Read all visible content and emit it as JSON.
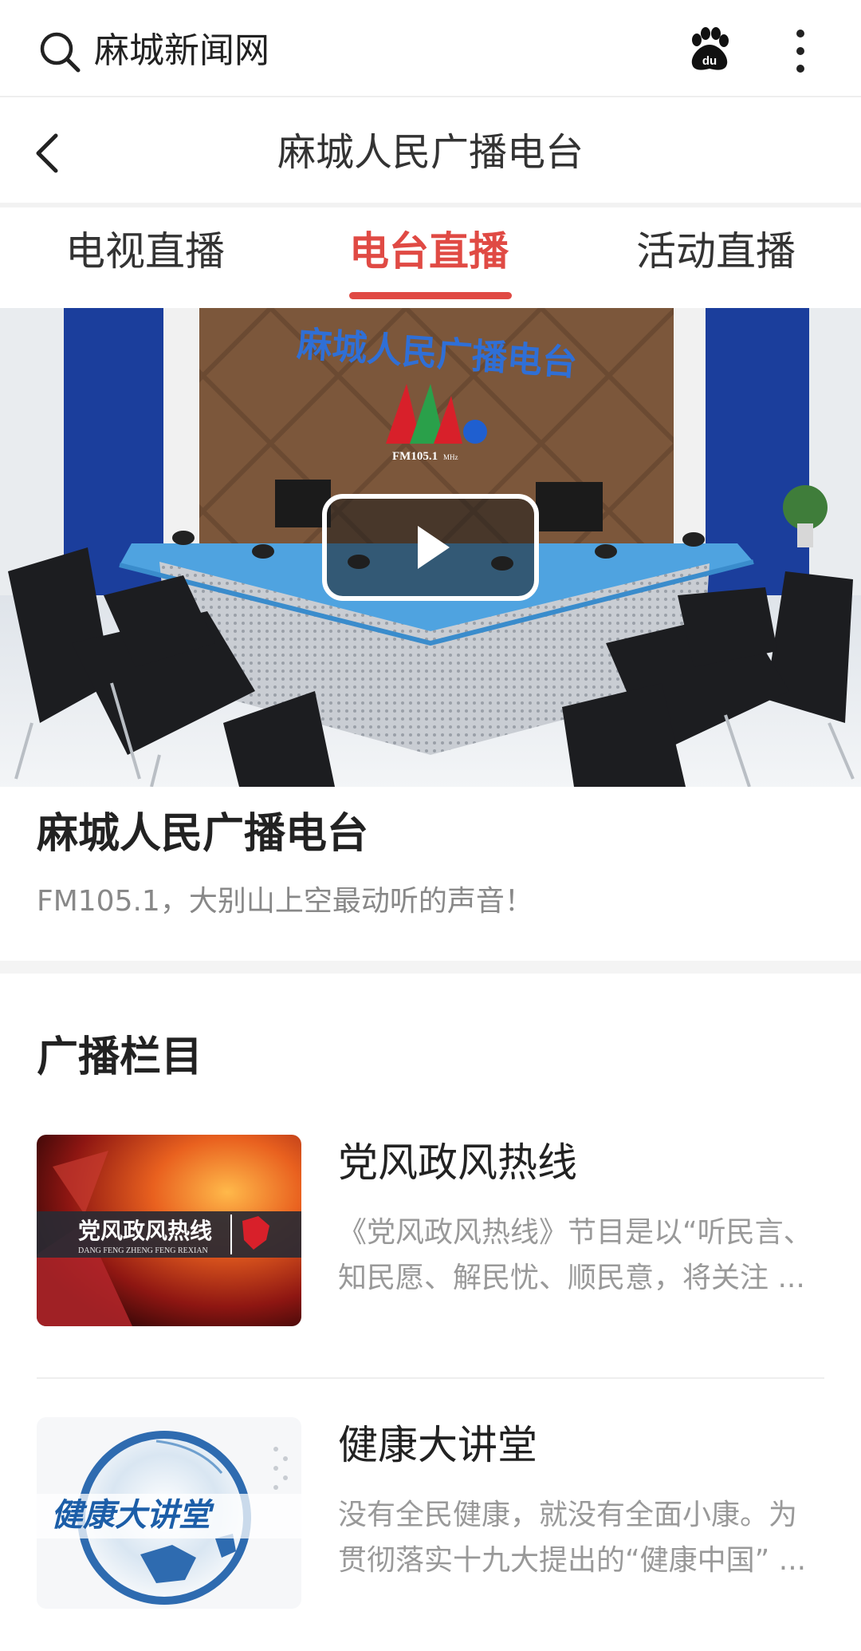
{
  "search": {
    "text": "麻城新闻网"
  },
  "header": {
    "title": "麻城人民广播电台"
  },
  "tabs": [
    {
      "label": "电视直播",
      "active": false
    },
    {
      "label": "电台直播",
      "active": true
    },
    {
      "label": "活动直播",
      "active": false
    }
  ],
  "hero": {
    "wall_sign": "麻城人民广播电台",
    "logo_text": "FM105.1",
    "logo_unit": "MHz"
  },
  "station": {
    "name": "麻城人民广播电台",
    "description": "FM105.1，大别山上空最动听的声音！"
  },
  "section": {
    "title": "广播栏目"
  },
  "programs": [
    {
      "name": "党风政风热线",
      "thumb_title": "党风政风热线",
      "thumb_subtitle": "DANG FENG ZHENG FENG REXIAN",
      "description": "《党风政风热线》节目是以“听民言、知民愿、解民忧、顺民意，将关注 ..."
    },
    {
      "name": "健康大讲堂",
      "thumb_title": "健康大讲堂",
      "description": "没有全民健康，就没有全面小康。为贯彻落实十九大提出的“健康中国” ..."
    }
  ],
  "colors": {
    "accent": "#e04a44",
    "text_primary": "#222222",
    "text_secondary": "#999999"
  }
}
